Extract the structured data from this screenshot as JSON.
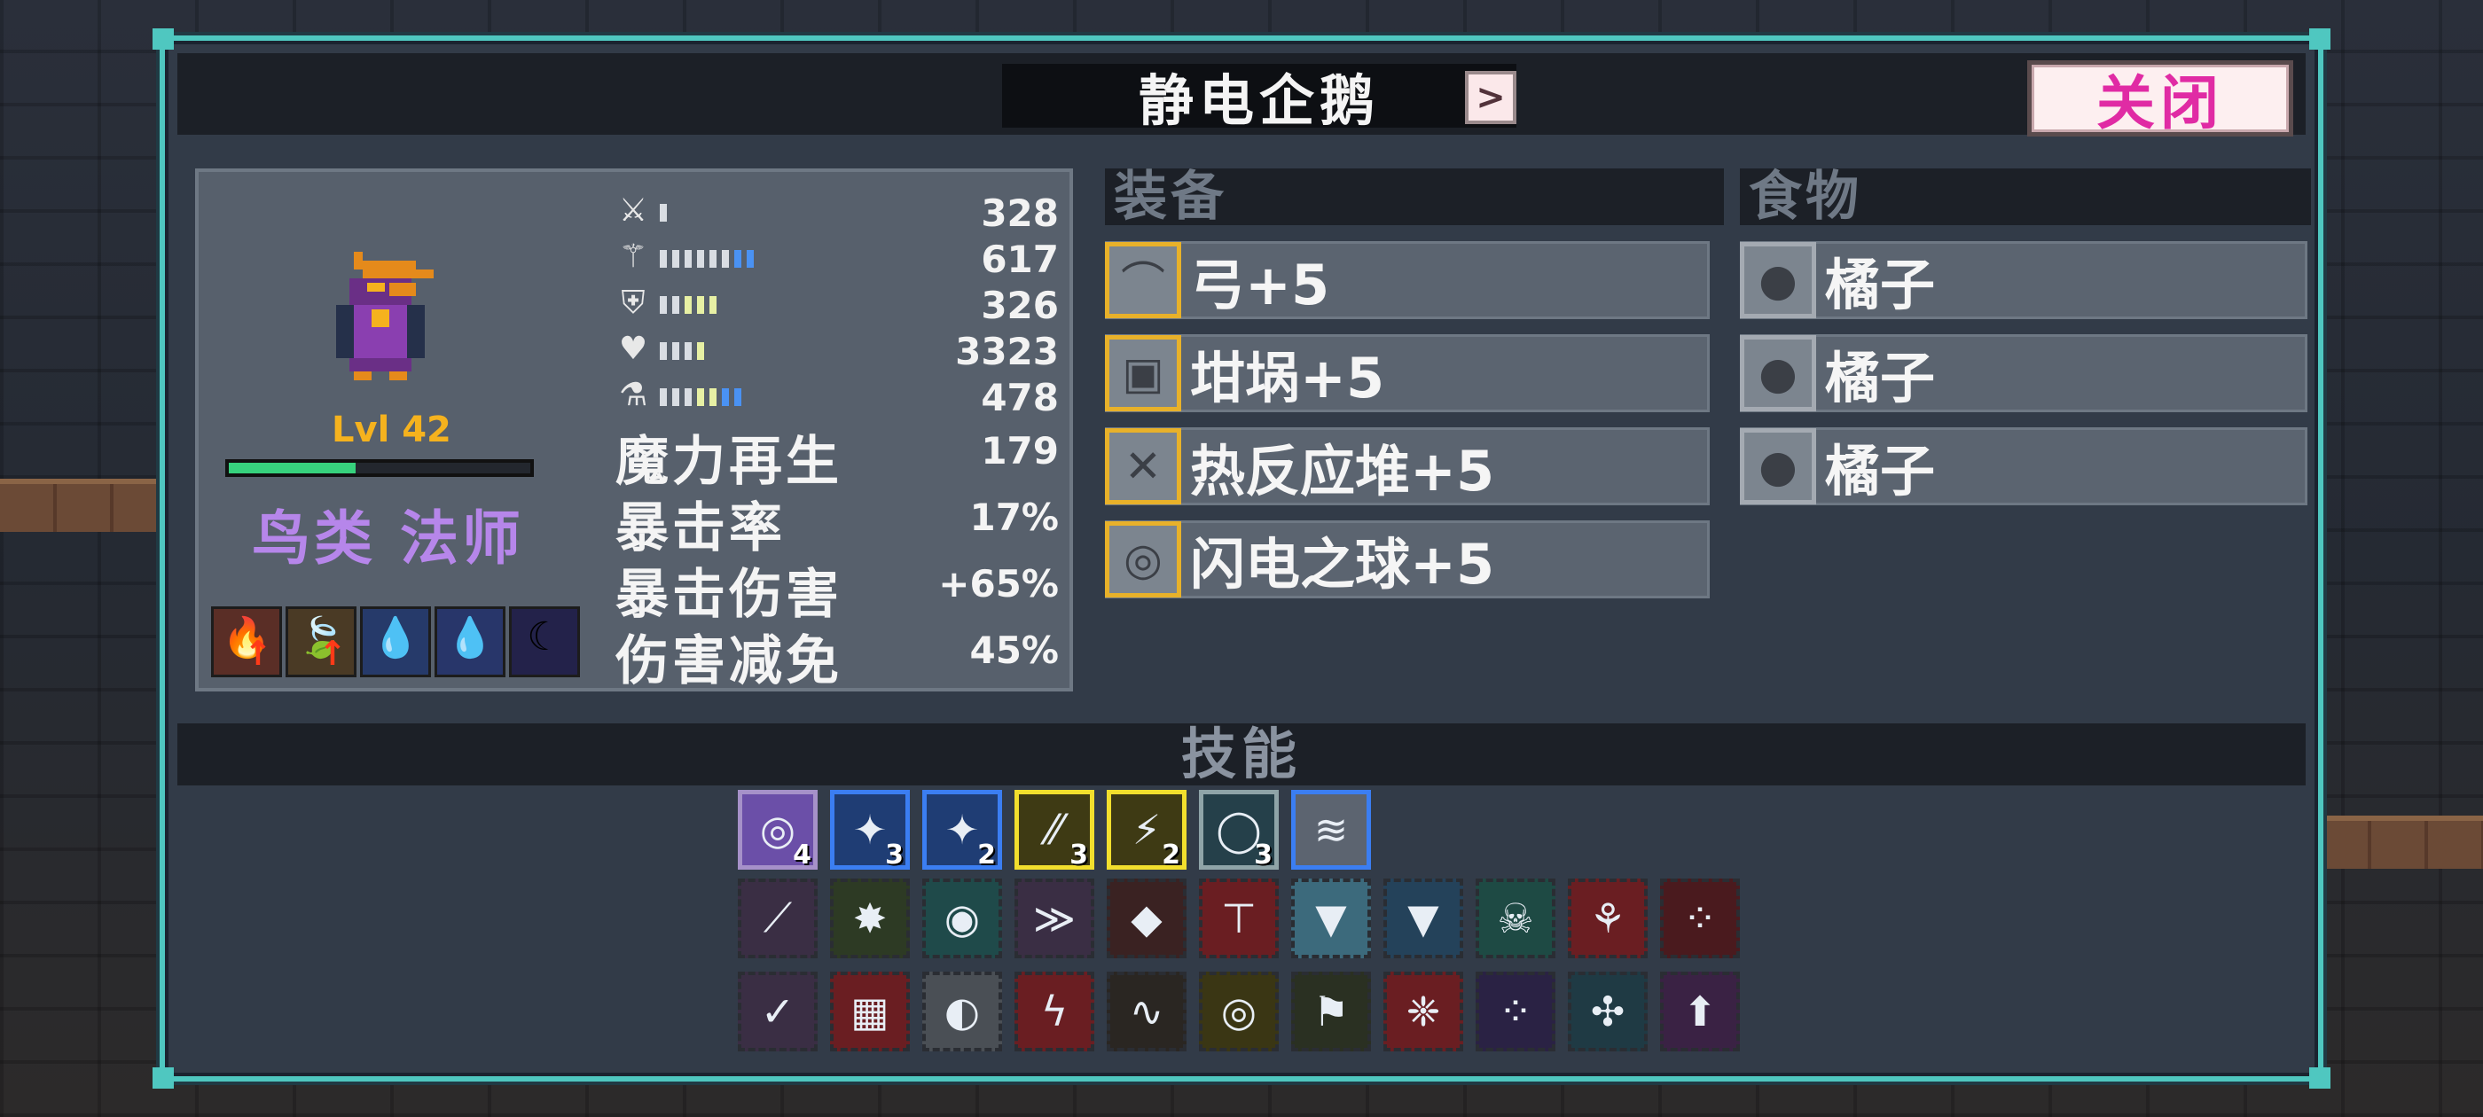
{
  "title": "静电企鹅",
  "nav": {
    "prev": "<",
    "next": ">"
  },
  "close_label": "关闭",
  "character": {
    "level": "Lvl 42",
    "xp_fraction": 0.42,
    "classes": "鸟类 法师",
    "portrait_icon": "penguin-mage-sprite",
    "traits": [
      {
        "icon": "fire-trait-icon",
        "glyph": "🔥",
        "up": true
      },
      {
        "icon": "leaf-trait-icon",
        "glyph": "🍃",
        "up": true
      },
      {
        "icon": "water-drop-trait-icon",
        "glyph": "💧",
        "up": false
      },
      {
        "icon": "water-fire-trait-icon",
        "glyph": "💧",
        "up": false
      },
      {
        "icon": "moon-trait-icon",
        "glyph": "☾",
        "up": false
      }
    ]
  },
  "stats_bars": [
    {
      "icon": "sword-icon",
      "glyph": "⚔",
      "value": "328",
      "segments": 1,
      "blue": 0,
      "yellow": 0
    },
    {
      "icon": "magic-staff-icon",
      "glyph": "⚚",
      "value": "617",
      "segments": 8,
      "blue": 2,
      "yellow": 0
    },
    {
      "icon": "shield-icon",
      "glyph": "⛨",
      "value": "326",
      "segments": 5,
      "blue": 0,
      "yellow": 3
    },
    {
      "icon": "heart-icon",
      "glyph": "♥",
      "value": "3323",
      "segments": 4,
      "blue": 0,
      "yellow": 1
    },
    {
      "icon": "mana-flask-icon",
      "glyph": "⚗",
      "value": "478",
      "segments": 7,
      "blue": 2,
      "yellow": 2
    }
  ],
  "stats_text": [
    {
      "label": "魔力再生",
      "value": "179"
    },
    {
      "label": "暴击率",
      "value": "17%"
    },
    {
      "label": "暴击伤害",
      "value": "+65%"
    },
    {
      "label": "伤害减免",
      "value": "45%"
    }
  ],
  "equipment_header": "装备",
  "equipment": [
    {
      "name": "弓+5",
      "icon": "bow-icon",
      "glyph": "⌒"
    },
    {
      "name": "坩埚+5",
      "icon": "crucible-icon",
      "glyph": "▣"
    },
    {
      "name": "热反应堆+5",
      "icon": "reactor-icon",
      "glyph": "✕"
    },
    {
      "name": "闪电之球+5",
      "icon": "lightning-orb-icon",
      "glyph": "◎"
    }
  ],
  "food_header": "食物",
  "food": [
    {
      "name": "橘子",
      "icon": "orange-icon",
      "glyph": "●"
    },
    {
      "name": "橘子",
      "icon": "orange-icon",
      "glyph": "●"
    },
    {
      "name": "橘子",
      "icon": "orange-icon",
      "glyph": "●"
    }
  ],
  "skills_header": "技能",
  "active_skills": [
    {
      "icon": "sonic-wave-skill-icon",
      "glyph": "◎",
      "count": "4",
      "color": "#6b4fa8",
      "border": "#a691c9"
    },
    {
      "icon": "ice-shard-skill-icon",
      "glyph": "✦",
      "count": "3",
      "color": "#1f3d74",
      "border": "#3b7ef2"
    },
    {
      "icon": "ice-burst-skill-icon",
      "glyph": "✦",
      "count": "2",
      "color": "#1f3d74",
      "border": "#3b7ef2"
    },
    {
      "icon": "spark-skill-icon",
      "glyph": "⁄⁄",
      "count": "3",
      "color": "#3e3a14",
      "border": "#f2df2d"
    },
    {
      "icon": "lightning-bolt-skill-icon",
      "glyph": "⚡",
      "count": "2",
      "color": "#3e3a14",
      "border": "#f2df2d"
    },
    {
      "icon": "chain-orb-skill-icon",
      "glyph": "◯",
      "count": "3",
      "color": "#25404a",
      "border": "#8fa4a8"
    },
    {
      "icon": "blizzard-skill-icon",
      "glyph": "≋",
      "count": "",
      "color": "#5c6470",
      "border": "#3b7ef2"
    }
  ],
  "passive_skills_row1": [
    {
      "icon": "dark-staff-passive-icon",
      "glyph": "⟋",
      "color": "#3a2e44"
    },
    {
      "icon": "green-totem-passive-icon",
      "glyph": "✸",
      "color": "#2d3a24"
    },
    {
      "icon": "ice-pot-passive-icon",
      "glyph": "◉",
      "color": "#1f4a4a"
    },
    {
      "icon": "shadow-claw-passive-icon",
      "glyph": "≫",
      "color": "#3a2e44"
    },
    {
      "icon": "crimson-gem-passive-icon",
      "glyph": "◆",
      "color": "#3a2222"
    },
    {
      "icon": "red-banner-passive-icon",
      "glyph": "⊤",
      "color": "#6a1e22"
    },
    {
      "icon": "icicle-passive-icon",
      "glyph": "▼",
      "color": "#3c6a7c"
    },
    {
      "icon": "frost-banner-passive-icon",
      "glyph": "▼",
      "color": "#24425a"
    },
    {
      "icon": "skull-aura-passive-icon",
      "glyph": "☠",
      "color": "#1e4a44"
    },
    {
      "icon": "rune-passive-icon",
      "glyph": "⚘",
      "color": "#6a1e22"
    },
    {
      "icon": "blood-dots-passive-icon",
      "glyph": "⁘",
      "color": "#4a1a1e"
    }
  ],
  "passive_skills_row2": [
    {
      "icon": "ice-fang-passive-icon",
      "glyph": "✓",
      "color": "#3a2e44"
    },
    {
      "icon": "red-scroll-passive-icon",
      "glyph": "▦",
      "color": "#6a1e22"
    },
    {
      "icon": "stone-disc-passive-icon",
      "glyph": "◐",
      "color": "#4a4f55"
    },
    {
      "icon": "red-charm-passive-icon",
      "glyph": "ϟ",
      "color": "#6a1e22"
    },
    {
      "icon": "gold-chain-passive-icon",
      "glyph": "∿",
      "color": "#2a2622"
    },
    {
      "icon": "gold-ring-passive-icon",
      "glyph": "◎",
      "color": "#3a3614"
    },
    {
      "icon": "altar-passive-icon",
      "glyph": "⚑",
      "color": "#2a3022"
    },
    {
      "icon": "blood-claw-passive-icon",
      "glyph": "❈",
      "color": "#6a1e22"
    },
    {
      "icon": "void-orbs-passive-icon",
      "glyph": "⁘",
      "color": "#2a2244"
    },
    {
      "icon": "ice-totem-passive-icon",
      "glyph": "✣",
      "color": "#1f3a44"
    },
    {
      "icon": "purple-potion-passive-icon",
      "glyph": "⬆",
      "color": "#3a2244"
    }
  ],
  "colors": {
    "panel_border": "#4fc7c0",
    "close_text": "#e02ba4",
    "class_text": "#b686ea",
    "level_text": "#f5b21e",
    "xp_fill": "#37d27d",
    "equip_border": "#e8b12a"
  }
}
